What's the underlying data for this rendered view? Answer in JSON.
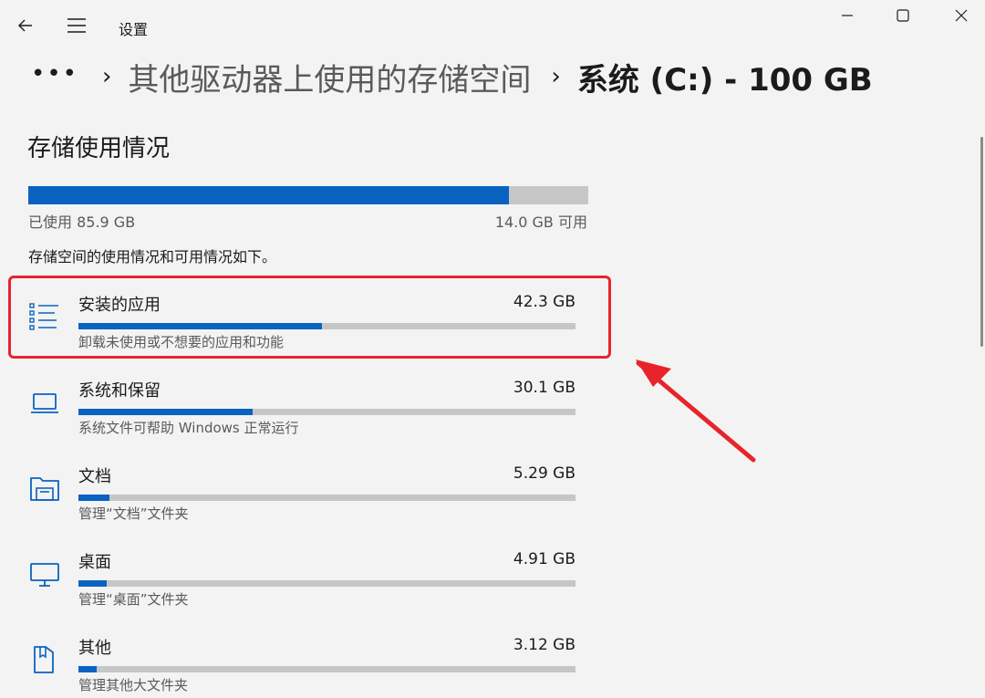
{
  "window": {
    "title": "设置",
    "back_icon": "back-arrow-icon",
    "menu_icon": "hamburger-menu-icon"
  },
  "breadcrumb": {
    "more": "•••",
    "items": [
      "其他驱动器上使用的存储空间"
    ],
    "current": "系统 (C:) - 100 GB"
  },
  "storage": {
    "section_title": "存储使用情况",
    "used_label": "已使用 85.9 GB",
    "free_label": "14.0 GB 可用",
    "used_fraction": 0.859,
    "description": "存储空间的使用情况和可用情况如下。"
  },
  "categories": [
    {
      "name": "安装的应用",
      "size": "42.3 GB",
      "sub": "卸载未使用或不想要的应用和功能",
      "fraction": 0.49,
      "icon": "apps-list-icon",
      "highlighted": true
    },
    {
      "name": "系统和保留",
      "size": "30.1 GB",
      "sub": "系统文件可帮助 Windows 正常运行",
      "fraction": 0.35,
      "icon": "laptop-icon",
      "highlighted": false
    },
    {
      "name": "文档",
      "size": "5.29 GB",
      "sub": "管理“文档”文件夹",
      "fraction": 0.062,
      "icon": "documents-folder-icon",
      "highlighted": false
    },
    {
      "name": "桌面",
      "size": "4.91 GB",
      "sub": "管理“桌面”文件夹",
      "fraction": 0.057,
      "icon": "monitor-icon",
      "highlighted": false
    },
    {
      "name": "其他",
      "size": "3.12 GB",
      "sub": "管理其他大文件夹",
      "fraction": 0.036,
      "icon": "other-folder-icon",
      "highlighted": false
    }
  ],
  "colors": {
    "accent": "#0a63c1",
    "bar_track": "#c6c6c6",
    "highlight": "#e8242b",
    "background": "#f3f3f3"
  }
}
